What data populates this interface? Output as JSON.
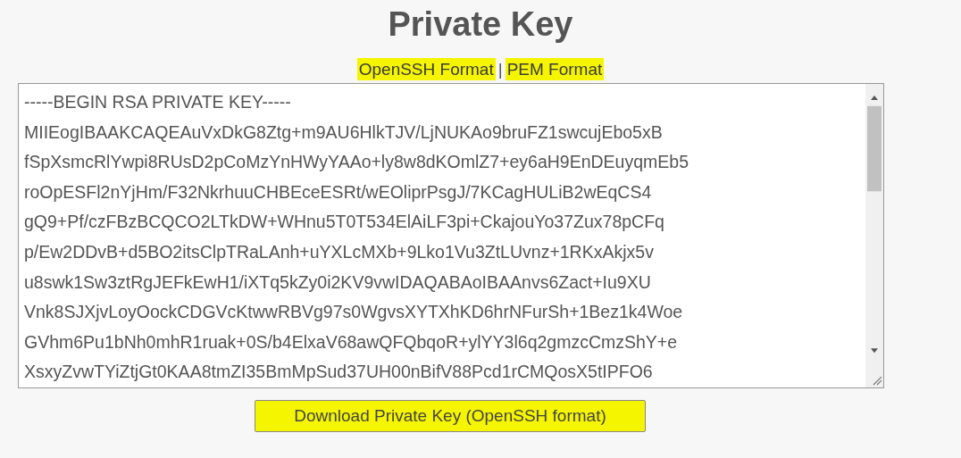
{
  "title": "Private Key",
  "format_links": [
    {
      "label": "OpenSSH Format",
      "highlighted": true
    },
    {
      "label": "PEM Format",
      "highlighted": true
    }
  ],
  "separator": "|",
  "key_text": {
    "lines": [
      "-----BEGIN RSA PRIVATE KEY-----",
      "MIIEogIBAAKCAQEAuVxDkG8Ztg+m9AU6HlkTJV/LjNUKAo9bruFZ1swcujEbo5xB",
      "fSpXsmcRlYwpi8RUsD2pCoMzYnHWyYAAo+ly8w8dKOmlZ7+ey6aH9EnDEuyqmEb5",
      "roOpESFl2nYjHm/F32NkrhuuCHBEceESRt/wEOliprPsgJ/7KCagHULiB2wEqCS4",
      "gQ9+Pf/czFBzBCQCO2LTkDW+WHnu5T0T534ElAiLF3pi+CkajouYo37Zux78pCFq",
      "p/Ew2DDvB+d5BO2itsClpTRaLAnh+uYXLcMXb+9Lko1Vu3ZtLUvnz+1RKxAkjx5v",
      "u8swk1Sw3ztRgJEFkEwH1/iXTq5kZy0i2KV9vwIDAQABAoIBAAnvs6Zact+Iu9XU",
      "Vnk8SJXjvLoyOockCDGVcKtwwRBVg97s0WgvsXYTXhKD6hrNFurSh+1Bez1k4Woe",
      "GVhm6Pu1bNh0mhR1ruak+0S/b4ElxaV68awQFQbqoR+ylYY3l6q2gmzcCmzShY+e",
      "XsxyZvwTYiZtjGt0KAA8tmZI35BmMpSud37UH00nBifV88Pcd1rCMQosX5tIPFO6"
    ]
  },
  "download_button": {
    "label": "Download Private Key (OpenSSH format)",
    "highlighted": true
  }
}
